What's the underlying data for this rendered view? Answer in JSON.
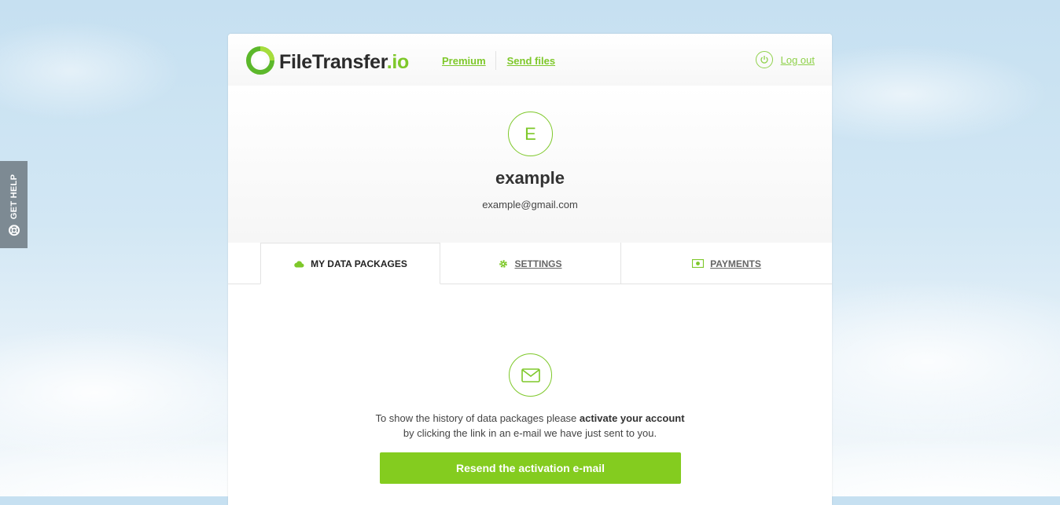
{
  "help_tab": {
    "label": "GET HELP",
    "icon": "lifebuoy-icon"
  },
  "header": {
    "logo": {
      "name": "FileTransfer",
      "tld": ".io"
    },
    "nav": [
      {
        "label": "Premium"
      },
      {
        "label": "Send files"
      }
    ],
    "logout": {
      "label": "Log out",
      "icon": "power-icon"
    }
  },
  "profile": {
    "avatar_letter": "E",
    "username": "example",
    "email": "example@gmail.com"
  },
  "tabs": [
    {
      "label": "MY DATA PACKAGES",
      "icon": "cloud-icon",
      "active": true
    },
    {
      "label": "SETTINGS",
      "icon": "gear-icon",
      "active": false
    },
    {
      "label": "PAYMENTS",
      "icon": "money-icon",
      "active": false
    }
  ],
  "content": {
    "icon": "envelope-icon",
    "message_line1_pre": "To show the history of data packages please ",
    "message_line1_bold": "activate your account",
    "message_line2": "by clicking the link in an e-mail we have just sent to you.",
    "resend_button": "Resend the activation e-mail"
  },
  "colors": {
    "accent": "#7ec82a",
    "button": "#84cc1f",
    "help_tab": "#7d8a93"
  }
}
